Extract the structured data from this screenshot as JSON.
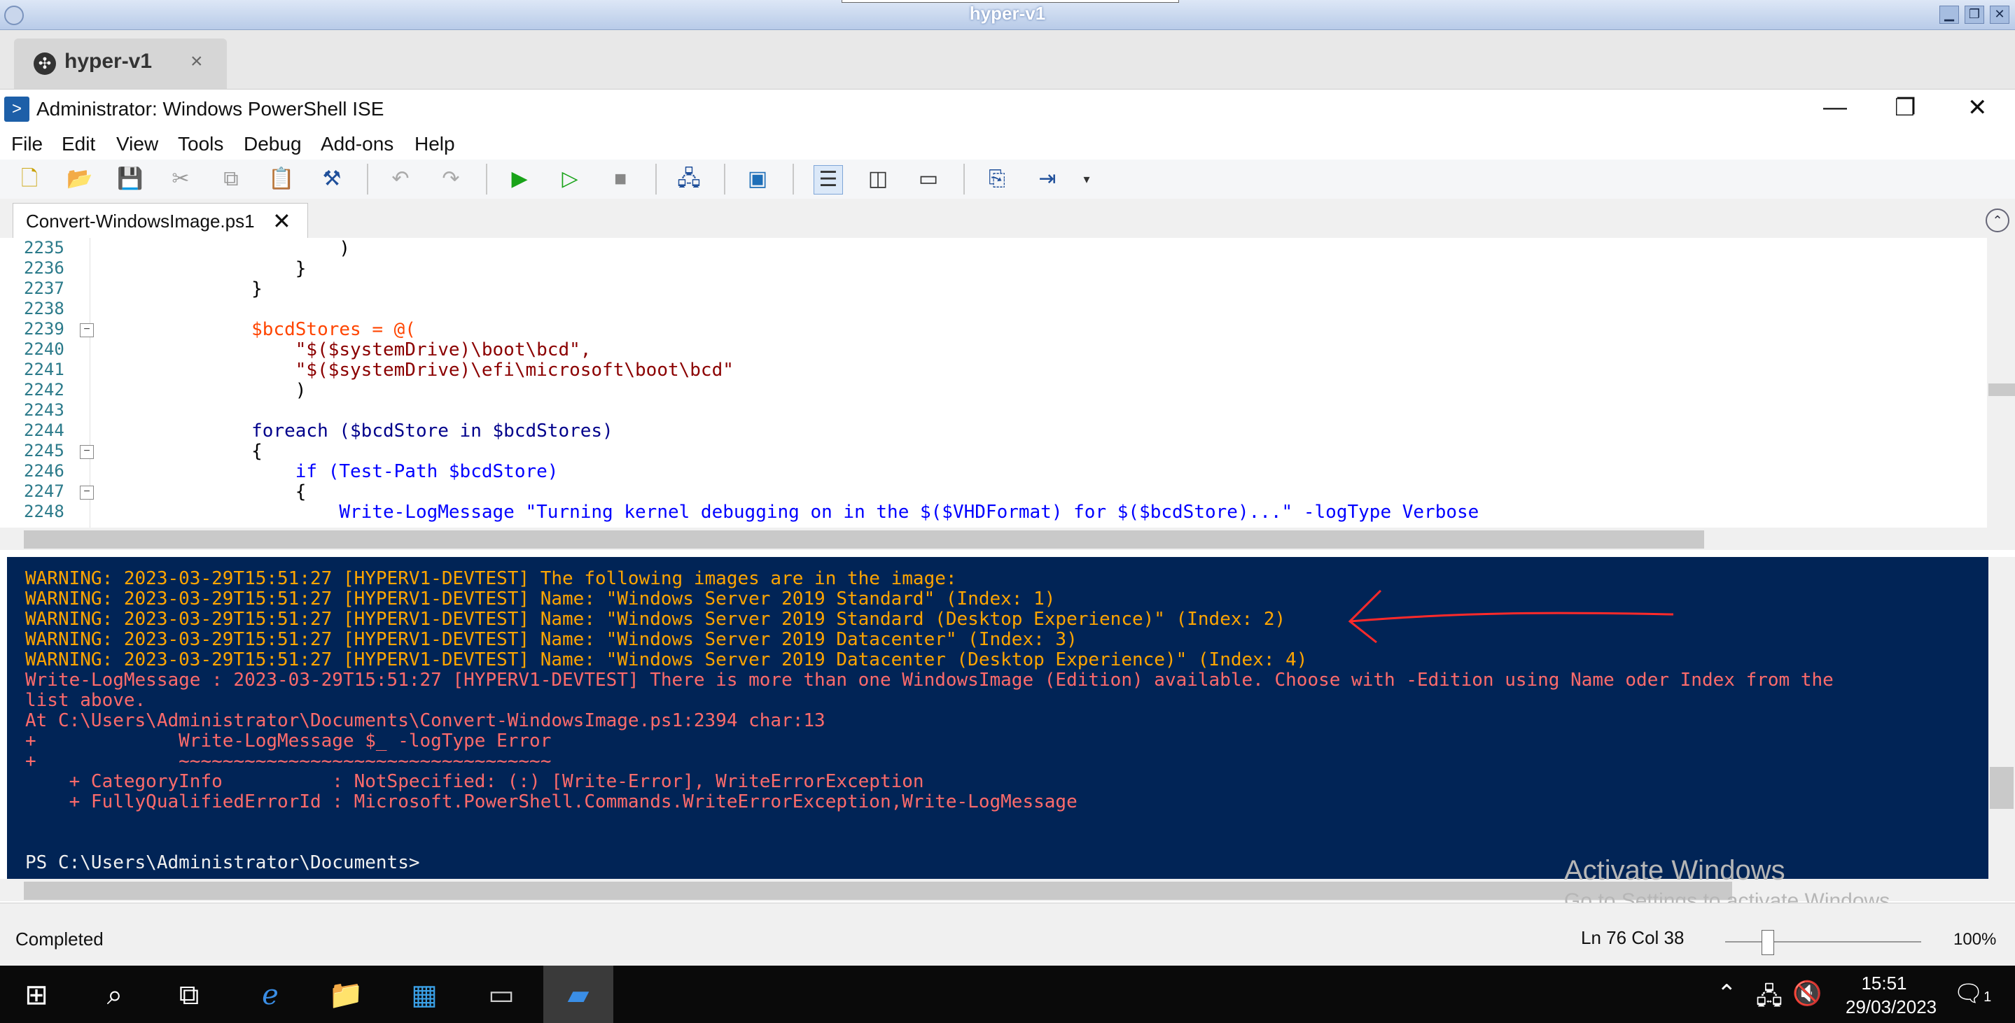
{
  "vm_window": {
    "title": "hyper-v1",
    "tab_label": "hyper-v1",
    "tab_close": "×",
    "min": "▁",
    "restore": "❐",
    "close": "✕"
  },
  "ise": {
    "title": "Administrator: Windows PowerShell ISE",
    "icon": ">",
    "controls": {
      "minimize": "—",
      "restore": "❐",
      "close": "✕"
    },
    "menu": [
      "File",
      "Edit",
      "View",
      "Tools",
      "Debug",
      "Add-ons",
      "Help"
    ],
    "script_tab": {
      "label": "Convert-WindowsImage.ps1",
      "close": "✕"
    }
  },
  "editor": {
    "line_numbers": [
      "2235",
      "2236",
      "2237",
      "2238",
      "2239",
      "2240",
      "2241",
      "2242",
      "2243",
      "2244",
      "2245",
      "2246",
      "2247",
      "2248"
    ],
    "lines": [
      "                      )",
      "                  }",
      "              }",
      "",
      "              $bcdStores = @(",
      "                  \"$($systemDrive)\\boot\\bcd\",",
      "                  \"$($systemDrive)\\efi\\microsoft\\boot\\bcd\"",
      "                  )",
      "",
      "              foreach ($bcdStore in $bcdStores)",
      "              {",
      "                  if (Test-Path $bcdStore)",
      "                  {",
      "                      Write-LogMessage \"Turning kernel debugging on in the $($VHDFormat) for $($bcdStore)...\" -logType Verbose"
    ]
  },
  "console": {
    "lines": [
      "WARNING: 2023-03-29T15:51:27 [HYPERV1-DEVTEST] The following images are in the image:",
      "WARNING: 2023-03-29T15:51:27 [HYPERV1-DEVTEST] Name: \"Windows Server 2019 Standard\" (Index: 1)",
      "WARNING: 2023-03-29T15:51:27 [HYPERV1-DEVTEST] Name: \"Windows Server 2019 Standard (Desktop Experience)\" (Index: 2)",
      "WARNING: 2023-03-29T15:51:27 [HYPERV1-DEVTEST] Name: \"Windows Server 2019 Datacenter\" (Index: 3)",
      "WARNING: 2023-03-29T15:51:27 [HYPERV1-DEVTEST] Name: \"Windows Server 2019 Datacenter (Desktop Experience)\" (Index: 4)",
      "Write-LogMessage : 2023-03-29T15:51:27 [HYPERV1-DEVTEST] There is more than one WindowsImage (Edition) available. Choose with -Edition using Name oder Index from the",
      "list above.",
      "At C:\\Users\\Administrator\\Documents\\Convert-WindowsImage.ps1:2394 char:13",
      "+             Write-LogMessage $_ -logType Error",
      "+             ~~~~~~~~~~~~~~~~~~~~~~~~~~~~~~~~~~",
      "    + CategoryInfo          : NotSpecified: (:) [Write-Error], WriteErrorException",
      "    + FullyQualifiedErrorId : Microsoft.PowerShell.Commands.WriteErrorException,Write-LogMessage",
      "",
      "",
      "PS C:\\Users\\Administrator\\Documents>"
    ]
  },
  "watermark": {
    "line1": "Activate Windows",
    "line2": "Go to Settings to activate Windows."
  },
  "status": {
    "text": "Completed",
    "cursor": "Ln 76  Col 38",
    "zoom": "100%"
  },
  "taskbar": {
    "time": "15:51",
    "date": "29/03/2023",
    "notification_count": "1"
  },
  "colors": {
    "console_bg": "#012456",
    "warning": "#ffa500",
    "error": "#ff6b6b",
    "annotation": "#ff2a2a"
  }
}
